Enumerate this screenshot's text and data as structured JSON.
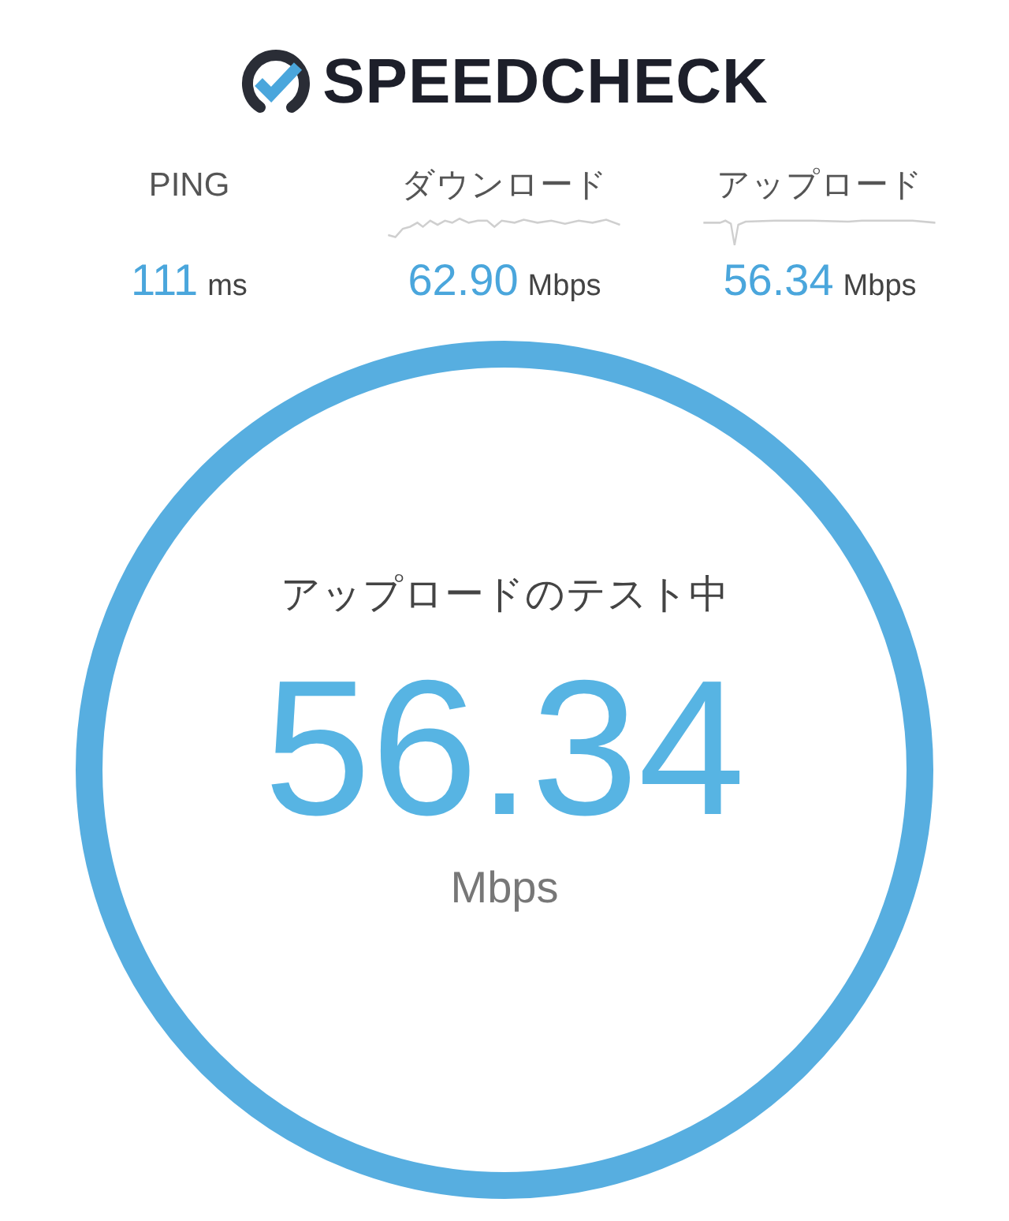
{
  "logo": {
    "text": "SPEEDCHECK"
  },
  "stats": [
    {
      "label": "PING",
      "value": "111",
      "unit": "ms",
      "kind": "plain"
    },
    {
      "label": "ダウンロード",
      "value": "62.90",
      "unit": "Mbps",
      "kind": "graph"
    },
    {
      "label": "アップロード",
      "value": "56.34",
      "unit": "Mbps",
      "kind": "graph"
    }
  ],
  "gauge": {
    "status": "アップロードのテスト中",
    "value": "56.34",
    "unit": "Mbps"
  }
}
